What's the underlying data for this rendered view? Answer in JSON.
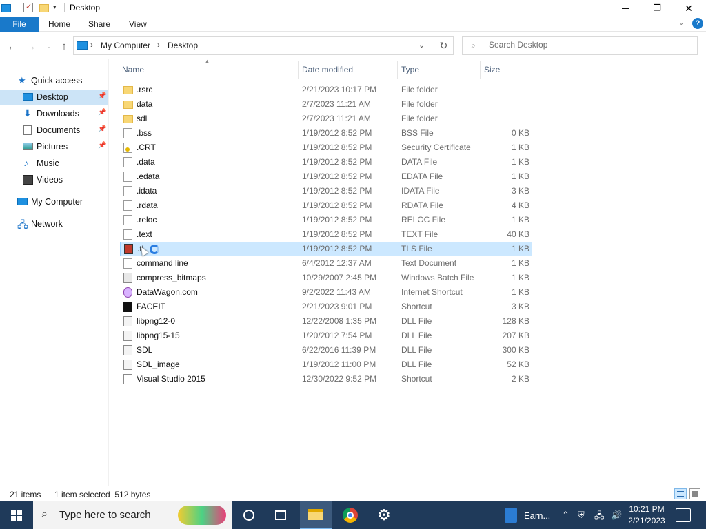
{
  "window": {
    "title": "Desktop",
    "minimize": "—",
    "maximize": "❐",
    "close": "✕"
  },
  "ribbon": {
    "tabs": [
      "File",
      "Home",
      "Share",
      "View"
    ],
    "help": "?"
  },
  "nav": {
    "breadcrumbs": [
      "My Computer",
      "Desktop"
    ],
    "search_placeholder": "Search Desktop"
  },
  "sidebar": {
    "items": [
      {
        "label": "Quick access",
        "icon": "star-icon"
      },
      {
        "label": "Desktop",
        "icon": "desktop-icon",
        "active": true,
        "pinned": true
      },
      {
        "label": "Downloads",
        "icon": "download-icon",
        "pinned": true
      },
      {
        "label": "Documents",
        "icon": "documents-icon",
        "pinned": true
      },
      {
        "label": "Pictures",
        "icon": "pictures-icon",
        "pinned": true
      },
      {
        "label": "Music",
        "icon": "music-icon"
      },
      {
        "label": "Videos",
        "icon": "videos-icon"
      },
      {
        "label": "My Computer",
        "icon": "computer-icon"
      },
      {
        "label": "Network",
        "icon": "network-icon"
      }
    ]
  },
  "columns": [
    "Name",
    "Date modified",
    "Type",
    "Size"
  ],
  "files": [
    {
      "name": ".rsrc",
      "date": "2/21/2023 10:17 PM",
      "type": "File folder",
      "size": "",
      "icon": "folder-icon"
    },
    {
      "name": "data",
      "date": "2/7/2023 11:21 AM",
      "type": "File folder",
      "size": "",
      "icon": "folder-icon"
    },
    {
      "name": "sdl",
      "date": "2/7/2023 11:21 AM",
      "type": "File folder",
      "size": "",
      "icon": "folder-icon"
    },
    {
      "name": ".bss",
      "date": "1/19/2012 8:52 PM",
      "type": "BSS File",
      "size": "0 KB",
      "icon": "file-icon"
    },
    {
      "name": ".CRT",
      "date": "1/19/2012 8:52 PM",
      "type": "Security Certificate",
      "size": "1 KB",
      "icon": "certificate-icon"
    },
    {
      "name": ".data",
      "date": "1/19/2012 8:52 PM",
      "type": "DATA File",
      "size": "1 KB",
      "icon": "file-icon"
    },
    {
      "name": ".edata",
      "date": "1/19/2012 8:52 PM",
      "type": "EDATA File",
      "size": "1 KB",
      "icon": "file-icon"
    },
    {
      "name": ".idata",
      "date": "1/19/2012 8:52 PM",
      "type": "IDATA File",
      "size": "3 KB",
      "icon": "file-icon"
    },
    {
      "name": ".rdata",
      "date": "1/19/2012 8:52 PM",
      "type": "RDATA File",
      "size": "4 KB",
      "icon": "file-icon"
    },
    {
      "name": ".reloc",
      "date": "1/19/2012 8:52 PM",
      "type": "RELOC File",
      "size": "1 KB",
      "icon": "file-icon"
    },
    {
      "name": ".text",
      "date": "1/19/2012 8:52 PM",
      "type": "TEXT File",
      "size": "40 KB",
      "icon": "file-icon"
    },
    {
      "name": ".tl",
      "date": "1/19/2012 8:52 PM",
      "type": "TLS File",
      "size": "1 KB",
      "icon": "tls-file-icon",
      "selected": true
    },
    {
      "name": "command line",
      "date": "6/4/2012 12:37 AM",
      "type": "Text Document",
      "size": "1 KB",
      "icon": "text-document-icon"
    },
    {
      "name": "compress_bitmaps",
      "date": "10/29/2007 2:45 PM",
      "type": "Windows Batch File",
      "size": "1 KB",
      "icon": "batch-file-icon"
    },
    {
      "name": "DataWagon.com",
      "date": "9/2/2022 11:43 AM",
      "type": "Internet Shortcut",
      "size": "1 KB",
      "icon": "internet-shortcut-icon"
    },
    {
      "name": "FACEIT",
      "date": "2/21/2023 9:01 PM",
      "type": "Shortcut",
      "size": "3 KB",
      "icon": "faceit-icon"
    },
    {
      "name": "libpng12-0",
      "date": "12/22/2008 1:35 PM",
      "type": "DLL File",
      "size": "128 KB",
      "icon": "dll-icon"
    },
    {
      "name": "libpng15-15",
      "date": "1/20/2012 7:54 PM",
      "type": "DLL File",
      "size": "207 KB",
      "icon": "dll-icon"
    },
    {
      "name": "SDL",
      "date": "6/22/2016 11:39 PM",
      "type": "DLL File",
      "size": "300 KB",
      "icon": "dll-icon"
    },
    {
      "name": "SDL_image",
      "date": "1/19/2012 11:00 PM",
      "type": "DLL File",
      "size": "52 KB",
      "icon": "dll-icon"
    },
    {
      "name": "Visual Studio 2015",
      "date": "12/30/2022 9:52 PM",
      "type": "Shortcut",
      "size": "2 KB",
      "icon": "shortcut-icon"
    }
  ],
  "status": {
    "count": "21 items",
    "selection": "1 item selected  512 bytes"
  },
  "taskbar": {
    "search_placeholder": "Type here to search",
    "pinned_app": "Earn...",
    "time": "10:21 PM",
    "date": "2/21/2023"
  },
  "colors": {
    "accent": "#1979ca",
    "selection": "#cce8ff",
    "sidebar_active": "#cce4f7",
    "taskbar": "#1f3a5a"
  }
}
